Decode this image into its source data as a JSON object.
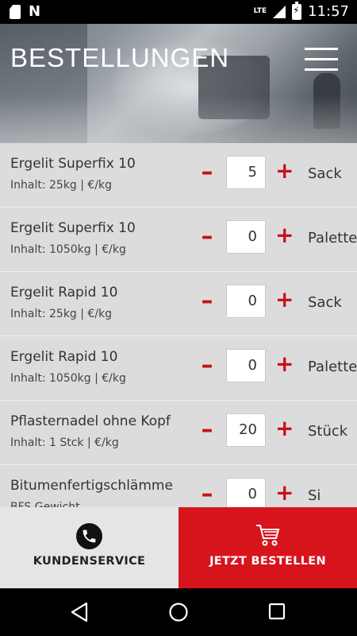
{
  "status_bar": {
    "network_label": "LTE",
    "time": "11:57",
    "icons": [
      "sd-card-icon",
      "n-notification-icon",
      "signal-icon",
      "battery-charging-icon"
    ]
  },
  "header": {
    "title": "BESTELLUNGEN",
    "menu_icon": "hamburger-menu-icon"
  },
  "products": [
    {
      "name": "Ergelit Superfix 10",
      "info": "Inhalt: 25kg |        €/kg",
      "quantity": "5",
      "unit": "Sack"
    },
    {
      "name": "Ergelit Superfix 10",
      "info": "Inhalt: 1050kg |        €/kg",
      "quantity": "0",
      "unit": "Palette"
    },
    {
      "name": "Ergelit Rapid 10",
      "info": "Inhalt: 25kg |        €/kg",
      "quantity": "0",
      "unit": "Sack"
    },
    {
      "name": "Ergelit Rapid 10",
      "info": "Inhalt: 1050kg |        €/kg",
      "quantity": "0",
      "unit": "Palette"
    },
    {
      "name": "Pflasternadel ohne Kopf",
      "info": "Inhalt: 1 Stck |        €/kg",
      "quantity": "20",
      "unit": "Stück"
    },
    {
      "name": "Bitumenfertigschlämme",
      "info": "BFS Gewicht",
      "quantity": "0",
      "unit": "Si"
    }
  ],
  "controls": {
    "minus": "–",
    "plus": "+"
  },
  "bottom": {
    "service_label": "KUNDENSERVICE",
    "order_label": "JETZT BESTELLEN"
  },
  "colors": {
    "accent": "#d7141c",
    "row_bg": "#dcdcdc"
  }
}
